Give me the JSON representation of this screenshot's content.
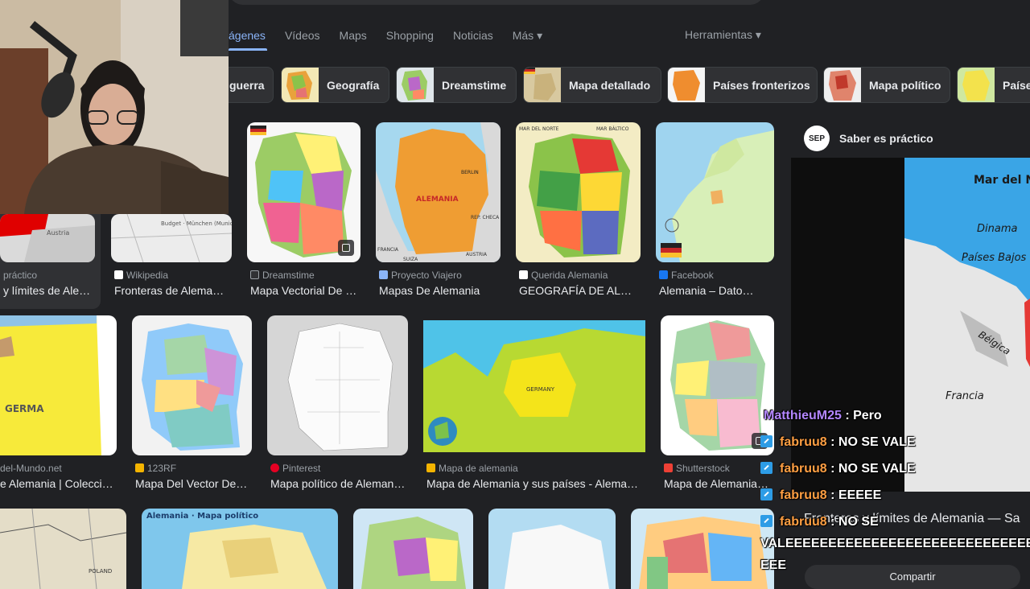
{
  "tabs": {
    "items": [
      {
        "label": "ágenes"
      },
      {
        "label": "Vídeos"
      },
      {
        "label": "Maps"
      },
      {
        "label": "Shopping"
      },
      {
        "label": "Noticias"
      },
      {
        "label": "Más ▾"
      }
    ],
    "tools_label": "Herramientas ▾"
  },
  "chips": [
    {
      "label": "guerra"
    },
    {
      "label": "Geografía"
    },
    {
      "label": "Dreamstime"
    },
    {
      "label": "Mapa detallado"
    },
    {
      "label": "Países fronterizos"
    },
    {
      "label": "Mapa político"
    },
    {
      "label": "Paíse"
    }
  ],
  "results": {
    "row1": [
      {
        "source": "práctico",
        "title": "y límites de Ale…"
      },
      {
        "source": "Wikipedia",
        "title": "Fronteras de Alema…",
        "map_text": "Budget · München (Munich) · Austria"
      },
      {
        "source": "Dreamstime",
        "title": "Mapa Vectorial De …"
      },
      {
        "source": "Proyecto Viajero",
        "title": "Mapas De Alemania",
        "map_text": [
          "ALEMANIA",
          "BERLIN",
          "REP. CHECA",
          "AUSTRIA",
          "SUIZA",
          "FRANCIA"
        ]
      },
      {
        "source": "Querida Alemania",
        "title": "GEOGRAFÍA DE AL…",
        "map_text": [
          "MAR DEL NORTE",
          "MAR BÁLTICO"
        ]
      },
      {
        "source": "Facebook",
        "title": "Alemania – Dato…"
      }
    ],
    "row2": [
      {
        "source": "del-Mundo.net",
        "title": "e Alemania | Colecci…",
        "map_text": "GERMA"
      },
      {
        "source": "123RF",
        "title": "Mapa Del Vector De…"
      },
      {
        "source": "Pinterest",
        "title": "Mapa político de Aleman…"
      },
      {
        "source": "Mapa de alemania",
        "title": "Mapa de Alemania y sus países - Alema…",
        "map_text": "GERMANY"
      },
      {
        "source": "Shutterstock",
        "title": "Mapa de Alemania…"
      }
    ],
    "row3": [
      {
        "map_text": "POLAND"
      },
      {
        "map_text": "Alemania · Mapa político"
      },
      {},
      {},
      {}
    ]
  },
  "side_panel": {
    "logo": "SEP",
    "channel": "Saber es práctico",
    "map_labels": [
      "Mar del Norte",
      "Dinama",
      "Países Bajos",
      "Bélgica",
      "Francia"
    ],
    "title": "Fronteras y límites de Alemania — Sa",
    "share_label": "Compartir"
  },
  "chat": [
    {
      "user": "MatthieuM25",
      "message": ": Pero",
      "mod": false
    },
    {
      "user": "fabruu8",
      "message": ": NO SE VALE",
      "mod": true
    },
    {
      "user": "fabruu8",
      "message": ": NO SE VALE",
      "mod": true
    },
    {
      "user": "fabruu8",
      "message": ": EEEEE",
      "mod": true
    },
    {
      "user": "fabruu8",
      "message": ": NO SE",
      "mod": true
    },
    {
      "message": "VALEEEEEEEEEEEEEEEEEEEEEEEEEEEEEEEE"
    },
    {
      "message": "EEE"
    }
  ],
  "colors": {
    "background": "#202124",
    "accent": "#8ab4f8",
    "chip": "#303134",
    "mod_badge": "#2d9ce6"
  }
}
